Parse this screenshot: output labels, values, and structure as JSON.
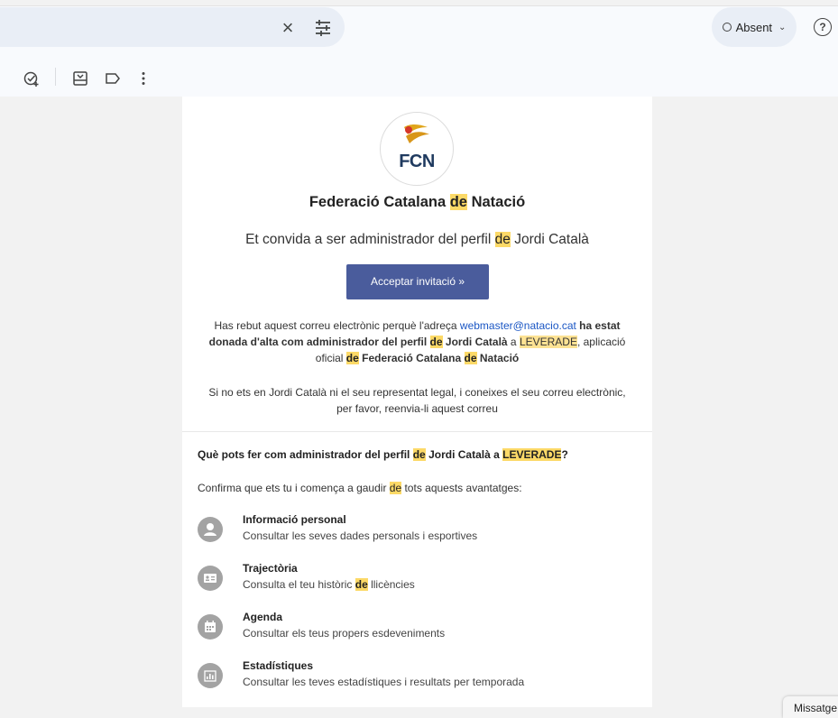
{
  "topbar": {
    "status_label": "Absent",
    "help_glyph": "?"
  },
  "email": {
    "org_logo_text": "FCN",
    "heading": {
      "pre": "Federació Catalana ",
      "hl": "de",
      "post": " Natació"
    },
    "subheading": {
      "pre": "Et convida a ser administrador del perfil ",
      "hl": "de",
      "post": " Jordi Català"
    },
    "accept_button": "Acceptar invitació »",
    "notice": {
      "t1": "Has rebut aquest correu electrònic perquè l'adreça ",
      "email_link": "webmaster@natacio.cat",
      "t2": " ha estat donada d'alta com administrador del perfil ",
      "hl1": "de",
      "t3": " Jordi Català",
      "t4": " a ",
      "brand": "LEVERADE",
      "t5": ", aplicació oficial ",
      "hl2": "de",
      "t6": "Federació Catalana ",
      "hl3": "de",
      "t7": " Natació"
    },
    "disclaimer": "Si no ets en Jordi Català ni el seu representat legal, i coneixes el seu correu electrònic, per favor, reenvia-li aquest correu",
    "question": {
      "pre": "Què pots fer com administrador del perfil ",
      "hl1": "de",
      "mid": " Jordi Català a ",
      "brand": "LEVERADE",
      "post": "?"
    },
    "intro": {
      "pre": "Confirma que ets tu i comença a gaudir ",
      "hl": "de",
      "post": " tots aquests avantatges:"
    },
    "features": [
      {
        "title": "Informació personal",
        "desc": "Consultar les seves dades personals i esportives",
        "icon": "person-icon"
      },
      {
        "title": "Trajectòria",
        "desc_pre": "Consulta el teu històric ",
        "desc_hl": "de",
        "desc_post": " llicències",
        "icon": "id-card-icon"
      },
      {
        "title": "Agenda",
        "desc": "Consultar els teus propers esdeveniments",
        "icon": "calendar-icon"
      },
      {
        "title": "Estadístiques",
        "desc": "Consultar les teves estadístiques i resultats per temporada",
        "icon": "bar-chart-icon"
      }
    ]
  },
  "chat": {
    "label": "Missatge"
  },
  "colors": {
    "highlight": "#fcd967",
    "button": "#4a5c9c",
    "link": "#1a56c4"
  }
}
